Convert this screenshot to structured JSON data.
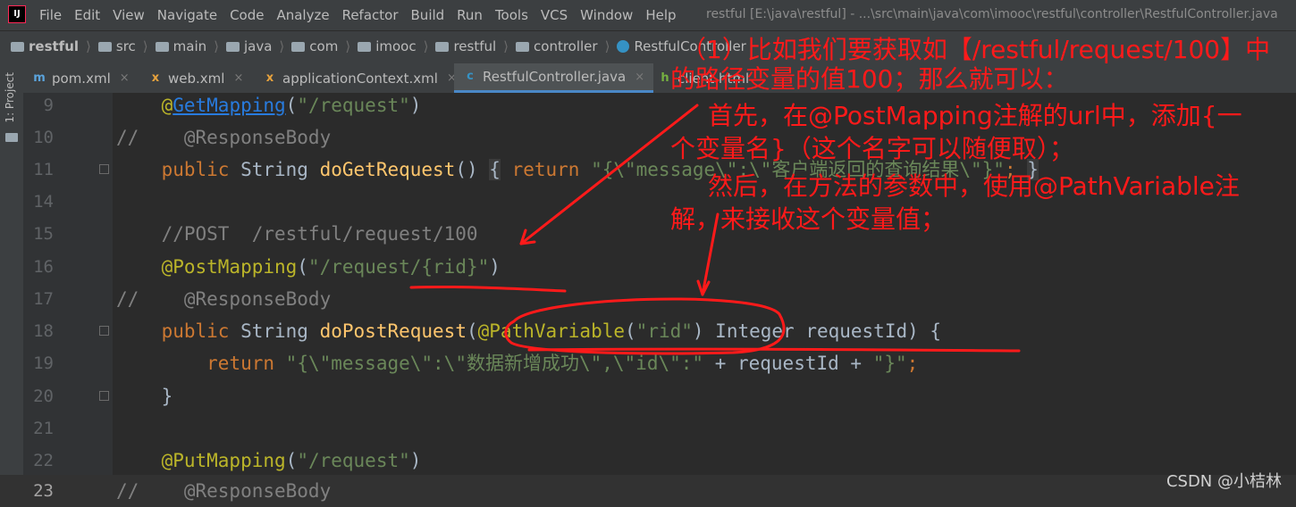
{
  "app": {
    "logo_text": "IJ",
    "menu": [
      "File",
      "Edit",
      "View",
      "Navigate",
      "Code",
      "Analyze",
      "Refactor",
      "Build",
      "Run",
      "Tools",
      "VCS",
      "Window",
      "Help"
    ],
    "window_title": "restful [E:\\java\\restful] - ...\\src\\main\\java\\com\\imooc\\restful\\controller\\RestfulController.java"
  },
  "breadcrumbs": [
    "restful",
    "src",
    "main",
    "java",
    "com",
    "imooc",
    "restful",
    "controller",
    "RestfulController"
  ],
  "side_panel_label": "1: Project",
  "tabs": [
    {
      "label": "pom.xml",
      "icon": "maven-icon",
      "icon_text": "m",
      "color": "#5ba4dd"
    },
    {
      "label": "web.xml",
      "icon": "xml-icon",
      "icon_text": "x",
      "color": "#e8a33d"
    },
    {
      "label": "applicationContext.xml",
      "icon": "spring-xml-icon",
      "icon_text": "x",
      "color": "#e8a33d"
    },
    {
      "label": "RestfulController.java",
      "icon": "java-class-icon",
      "icon_text": "c",
      "color": "#3592c4"
    },
    {
      "label": "client.html",
      "icon": "html-icon",
      "icon_text": "h",
      "color": "#76b041"
    }
  ],
  "code_lines": [
    {
      "n": "9",
      "parts": [
        [
          "    ",
          "p"
        ],
        [
          "@",
          "ann-y"
        ],
        [
          "GetMapping",
          "link"
        ],
        [
          "(",
          "p"
        ],
        [
          "\"/request\"",
          "str"
        ],
        [
          ")",
          "p"
        ]
      ]
    },
    {
      "n": "10",
      "parts": [
        [
          "//    @ResponseBody",
          "cmt"
        ]
      ]
    },
    {
      "n": "11",
      "parts": [
        [
          "    ",
          "p"
        ],
        [
          "public ",
          "kw"
        ],
        [
          "String ",
          "p"
        ],
        [
          "doGetRequest",
          "fn"
        ],
        [
          "() ",
          "p"
        ],
        [
          "{",
          "brace-hl"
        ],
        [
          " return ",
          "kw"
        ],
        [
          "\"{\\\"message\\\":\\\"客户端返回的查询结果\\\"}\"",
          "str"
        ],
        [
          "; ",
          "kw"
        ],
        [
          "}",
          "brace-hl"
        ]
      ]
    },
    {
      "n": "14",
      "parts": []
    },
    {
      "n": "15",
      "parts": [
        [
          "    //POST  /restful/request/100",
          "cmt"
        ]
      ]
    },
    {
      "n": "16",
      "parts": [
        [
          "    ",
          "p"
        ],
        [
          "@PostMapping",
          "ann-y"
        ],
        [
          "(",
          "p"
        ],
        [
          "\"/request/{rid}\"",
          "str"
        ],
        [
          ")",
          "p"
        ]
      ]
    },
    {
      "n": "17",
      "parts": [
        [
          "//    @ResponseBody",
          "cmt"
        ]
      ]
    },
    {
      "n": "18",
      "parts": [
        [
          "    ",
          "p"
        ],
        [
          "public ",
          "kw"
        ],
        [
          "String ",
          "p"
        ],
        [
          "doPostRequest",
          "fn"
        ],
        [
          "(",
          "p"
        ],
        [
          "@PathVariable",
          "ann-y"
        ],
        [
          "(",
          "p"
        ],
        [
          "\"rid\"",
          "str"
        ],
        [
          ") Integer requestId) {",
          "p"
        ]
      ]
    },
    {
      "n": "19",
      "parts": [
        [
          "        ",
          "p"
        ],
        [
          "return ",
          "kw"
        ],
        [
          "\"{\\\"message\\\":\\\"数据新增成功\\\",\\\"id\\\":\"",
          "str"
        ],
        [
          " + requestId + ",
          "p"
        ],
        [
          "\"}\"",
          "str"
        ],
        [
          ";",
          "kw"
        ]
      ]
    },
    {
      "n": "20",
      "parts": [
        [
          "    }",
          "p"
        ]
      ]
    },
    {
      "n": "21",
      "parts": []
    },
    {
      "n": "22",
      "parts": [
        [
          "    ",
          "p"
        ],
        [
          "@PutMapping",
          "ann-y"
        ],
        [
          "(",
          "p"
        ],
        [
          "\"/request\"",
          "str"
        ],
        [
          ")",
          "p"
        ]
      ]
    },
    {
      "n": "23",
      "parts": [
        [
          "//    @ResponseBody",
          "cmt"
        ]
      ]
    }
  ],
  "annotations": {
    "line1": "（1）比如我们要获取如【/restful/request/100】中",
    "line2": "的路径变量的值100；那么就可以：",
    "line3": "首先，在@PostMapping注解的url中，添加{一",
    "line4": "个变量名}（这个名字可以随便取）；",
    "line5": "然后，在方法的参数中，使用@PathVariable注",
    "line6": "解，来接收这个变量值；"
  },
  "watermark": "CSDN @小桔林"
}
